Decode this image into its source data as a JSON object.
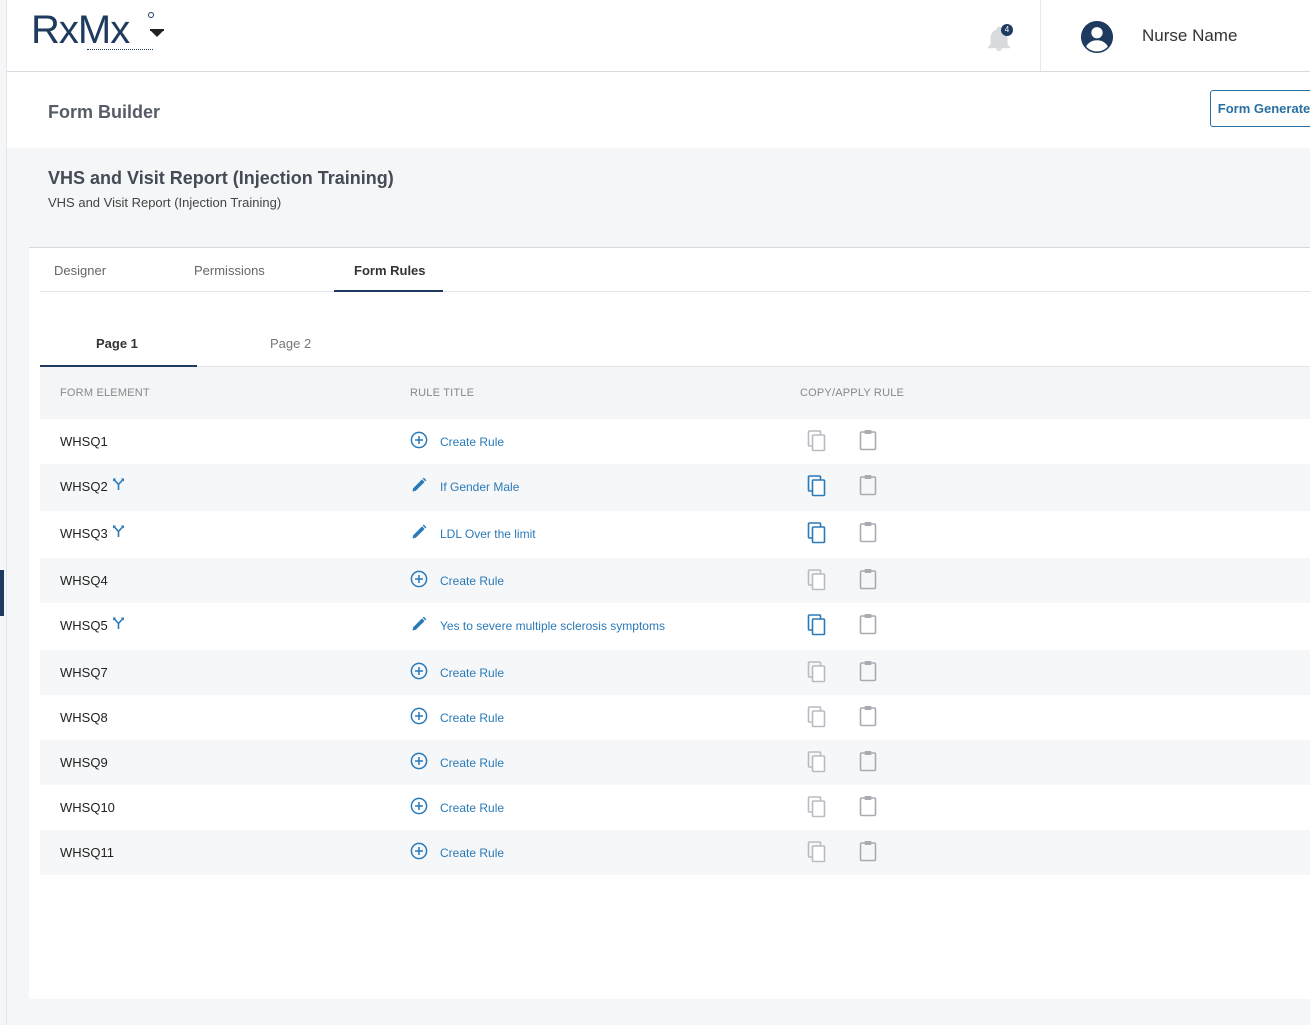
{
  "header": {
    "logo_text": "RxMx",
    "user_name": "Nurse Name",
    "notification_count": "4"
  },
  "page": {
    "title": "Form Builder",
    "form_generated_label": "Form Generated"
  },
  "form": {
    "name": "VHS and Visit Report (Injection Training)",
    "description": "VHS and Visit Report (Injection Training)"
  },
  "tabs": [
    {
      "label": "Designer",
      "active": false
    },
    {
      "label": "Permissions",
      "active": false
    },
    {
      "label": "Form Rules",
      "active": true
    }
  ],
  "subtabs": [
    {
      "label": "Page 1",
      "active": true
    },
    {
      "label": "Page 2",
      "active": false
    }
  ],
  "table": {
    "columns": [
      "FORM ELEMENT",
      "RULE TITLE",
      "COPY/APPLY RULE"
    ],
    "rows": [
      {
        "element": "WHSQ1",
        "has_rule": false,
        "rule_title": "Create Rule"
      },
      {
        "element": "WHSQ2",
        "has_rule": true,
        "rule_title": "If Gender Male"
      },
      {
        "element": "WHSQ3",
        "has_rule": true,
        "rule_title": "LDL Over the limit"
      },
      {
        "element": "WHSQ4",
        "has_rule": false,
        "rule_title": "Create Rule"
      },
      {
        "element": "WHSQ5",
        "has_rule": true,
        "rule_title": "Yes to severe multiple sclerosis symptoms"
      },
      {
        "element": "WHSQ7",
        "has_rule": false,
        "rule_title": "Create Rule"
      },
      {
        "element": "WHSQ8",
        "has_rule": false,
        "rule_title": "Create Rule"
      },
      {
        "element": "WHSQ9",
        "has_rule": false,
        "rule_title": "Create Rule"
      },
      {
        "element": "WHSQ10",
        "has_rule": false,
        "rule_title": "Create Rule"
      },
      {
        "element": "WHSQ11",
        "has_rule": false,
        "rule_title": "Create Rule"
      }
    ]
  },
  "colors": {
    "brand": "#1f3a5f",
    "link": "#2a7ab8",
    "icon_disabled": "#b8bcc2",
    "icon_active": "#2a7ab8"
  },
  "icons": {
    "notification": "bell-icon",
    "user": "user-avatar-icon",
    "branch": "branch-icon",
    "create": "plus-circle-icon",
    "edit": "pencil-icon",
    "copy": "copy-icon",
    "paste": "clipboard-icon"
  }
}
